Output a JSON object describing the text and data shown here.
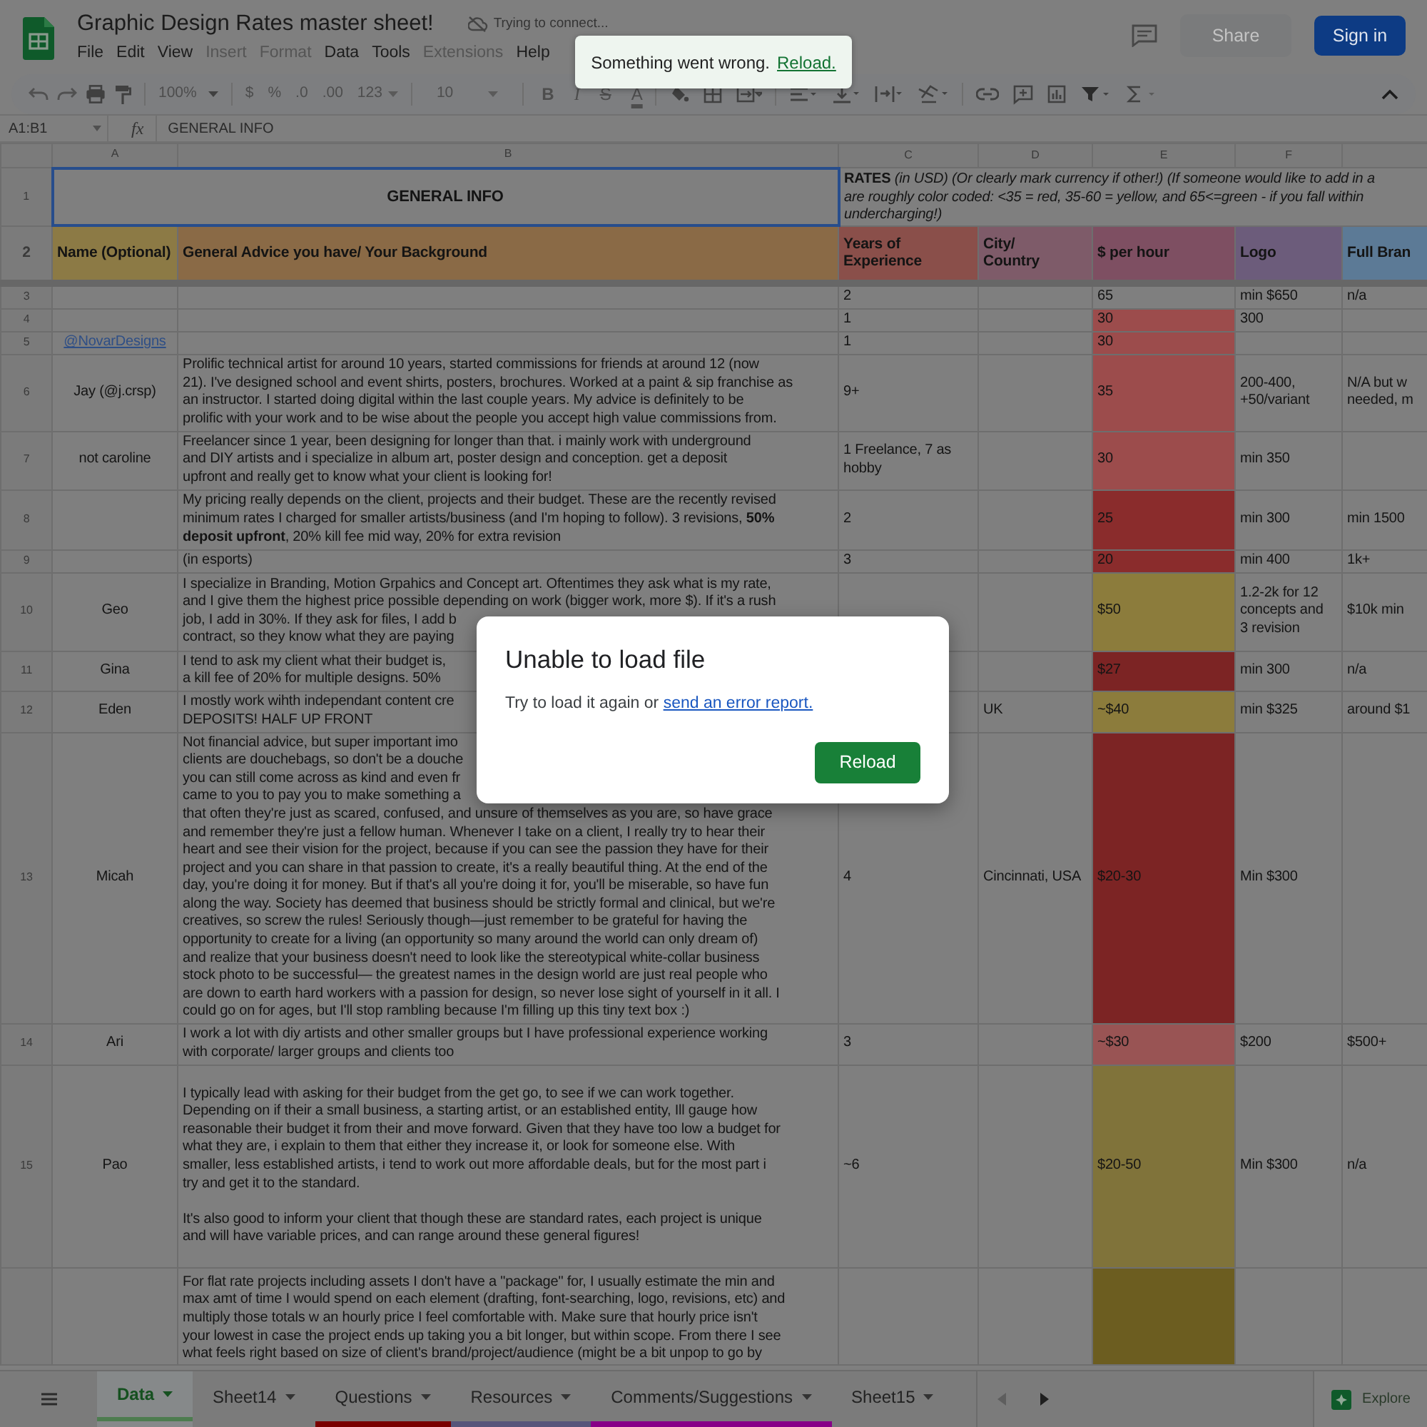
{
  "window": {
    "title": "Graphic Design Rates master sheet!",
    "connection_status": "Trying to connect..."
  },
  "menu": [
    {
      "label": "File",
      "disabled": false
    },
    {
      "label": "Edit",
      "disabled": false
    },
    {
      "label": "View",
      "disabled": false
    },
    {
      "label": "Insert",
      "disabled": true
    },
    {
      "label": "Format",
      "disabled": true
    },
    {
      "label": "Data",
      "disabled": false
    },
    {
      "label": "Tools",
      "disabled": false
    },
    {
      "label": "Extensions",
      "disabled": true
    },
    {
      "label": "Help",
      "disabled": false
    }
  ],
  "header_buttons": {
    "share": {
      "label": "Share",
      "disabled": true
    },
    "sign_in": "Sign in"
  },
  "toolbar": {
    "zoom": "100%",
    "currency": "$",
    "percent": "%",
    "decrease_decimals": ".0",
    "increase_decimals": ".00",
    "number_format": "123",
    "font_size": "10",
    "bold": "B",
    "italic": "I",
    "strikethrough": "S",
    "text_color": "A"
  },
  "formula_bar": {
    "name_box": "A1:B1",
    "fx": "fx",
    "value": "GENERAL INFO"
  },
  "sheet": {
    "columns": [
      "A",
      "B",
      "C",
      "D",
      "E",
      "F"
    ],
    "title_row": {
      "number": "1",
      "left": "GENERAL INFO",
      "right": [
        "**RATES** *(in USD) (Or clearly mark currency if other!) (If someone would like to add in a*",
        "*are roughly color coded: <35 = red, 35-60 = yellow, and 65<=green - if you fall within*",
        "*undercharging!)*"
      ]
    },
    "header_row": {
      "number": "2",
      "cells": [
        {
          "text": "Name (Optional)",
          "color": "#8c7a45"
        },
        {
          "text": "General Advice you have/ Your Background",
          "color": "#8a6a46"
        },
        {
          "text": "Years of\nExperience",
          "color": "#8a4f4a"
        },
        {
          "text": "City/\nCountry",
          "color": "#7e5b69"
        },
        {
          "text": "$ per hour",
          "color": "#7e4f62"
        },
        {
          "text": "Logo",
          "color": "#6c5c7b"
        },
        {
          "text": "Full Bran",
          "color": "#5c7a96"
        }
      ]
    },
    "rows": [
      {
        "number": "3",
        "a_link": false,
        "cells": {
          "c": "2",
          "e": "65",
          "f": "min $650",
          "g": "n/a"
        }
      },
      {
        "number": "4",
        "a_link": false,
        "color": "#9c4c4c",
        "cells": {
          "c": "1",
          "e": "30",
          "f": "300"
        }
      },
      {
        "number": "5",
        "a_link": true,
        "color": "#9c4c4c",
        "cells": {
          "a": "@NovarDesigns",
          "c": "1",
          "e": "30"
        }
      },
      {
        "number": "6",
        "a_link": false,
        "color": "#9c4c4c",
        "cells": {
          "a": "Jay (@j.crsp)",
          "b": "Prolific technical artist for around 10 years, started commissions for friends at around 12 (now\n21). I've designed school and event shirts, posters, brochures. Worked at a paint & sip franchise as\nan instructor. I started doing digital within the last couple years. My advice is definitely to be\nprolific with your work and to be wise about the people you accept high value commissions from.",
          "c": "9+",
          "e": "35",
          "f": "200-400,\n+50/variant",
          "g": "N/A but w\nneeded, m"
        }
      },
      {
        "number": "7",
        "a_link": false,
        "color": "#9c4c4c",
        "cells": {
          "a": "not caroline",
          "b": "Freelancer since 1 year, been designing for longer than that. i mainly work with underground\nand DIY artists and i specialize in album art, poster design and conception. get a deposit\nupfront and really get to know what your client is looking for!",
          "c": "1 Freelance, 7 as\nhobby",
          "e": "30",
          "f": "min 350"
        }
      },
      {
        "number": "8",
        "a_link": false,
        "color": "#8a2c2c",
        "cells": {
          "b": "My pricing really depends on the client, projects and their budget. These are the recently revised\nminimum rates I charged for smaller artists/business (and I'm hoping to follow). 3 revisions,  **50%**\n**deposit upfront**, 20% kill fee mid way, 20% for extra revision",
          "c": "2",
          "e": "25",
          "f": "min 300",
          "g": "min 1500"
        }
      },
      {
        "number": "9",
        "a_link": false,
        "color": "#8a2c2c",
        "cells": {
          "b": "(in esports)",
          "c": "3",
          "e": "20",
          "f": "min 400",
          "g": "1k+"
        }
      },
      {
        "number": "10",
        "a_link": false,
        "color": "#8c7c3c",
        "cells": {
          "a": "Geo",
          "b": [
            "I specialize in Branding, Motion Grpahics and Concept art. Oftentimes they ask what is my rate,",
            "and I give them the highest price possible depending on work (bigger work, more $). If it's a rush",
            "job, I add in 30%. If they ask for files, I add b",
            "contract, so they know what they are paying"
          ],
          "e": "$50",
          "f": "1.2-2k for 12\nconcepts and\n3 revision",
          "g": "$10k min"
        }
      },
      {
        "number": "11",
        "a_link": false,
        "color": "#7c2424",
        "cells": {
          "a": "Gina",
          "b": [
            "I tend to ask my client what their  budget is,",
            "a kill  fee of 20% for multiple designs.  50%"
          ],
          "e": "$27",
          "f": "min 300",
          "g": "n/a"
        }
      },
      {
        "number": "12",
        "a_link": false,
        "color": "#8c7c3c",
        "cells": {
          "a": "Eden",
          "b": [
            "I mostly work wihth independant content cre",
            "DEPOSITS! HALF UP FRONT"
          ],
          "d": "UK",
          "e": "~$40",
          "f": "min $325",
          "g": "around $1"
        }
      },
      {
        "number": "13",
        "a_link": false,
        "color": "#7c2424",
        "cells": {
          "a": "Micah",
          "b": [
            "Not financial advice, but super important imo",
            "clients are douchebags, so don't be a douche",
            "you can still come across as kind and even fr",
            "came to you to pay you to make something a",
            "that often they're just as scared, confused, and unsure of themselves as you are, so have grace",
            "and remember they're just a fellow human. Whenever I take on a client, I really try to hear their",
            "heart and see their vision for the project, because if you can see the passion they have for their",
            "project and you can share in that passion to create, it's a really beautiful thing. At the end of the",
            "day, you're doing it for money. But if that's all you're doing it for, you'll be miserable, so have fun",
            "along the way. Society has deemed that business should be strictly formal and clinical, but we're",
            "creatives, so screw the rules! Seriously though—just remember to be grateful for having the",
            "opportunity to create for a living (an opportunity so many around the world can only dream of)",
            "and realize that your business doesn't need to look like the stereotypical white-collar business",
            "stock photo to be successful— the greatest names in the design world are just real people who",
            "are down to earth hard workers with a passion for design, so never lose sight of yourself in it all. I",
            "could go on for ages, but I'll stop rambling because I'm filling up this tiny text box :)"
          ],
          "c": "4",
          "d": "Cincinnati, USA",
          "e": "$20-30",
          "f": "Min $300"
        }
      },
      {
        "number": "14",
        "a_link": false,
        "color": "#995454",
        "cells": {
          "a": "Ari",
          "b": "I work a lot with diy artists and other smaller groups but I have professional experience working\nwith corporate/ larger groups and clients too",
          "c": "3",
          "e": "~$30",
          "f": "$200",
          "g": "$500+"
        }
      },
      {
        "number": "15",
        "a_link": false,
        "color": "#80733a",
        "cells": {
          "a": "Pao",
          "b": "I typically lead with asking for their budget from the get go, to see if we can work together.\nDepending on if their a small business, a starting artist, or an established entity, Ill gauge how\nreasonable their budget it from their and move forward. Given that they have too low a budget for\nwhat they are, i explain to them that either they increase it, or look for someone else. With\nsmaller, less established artists, i tend to work out more affordable deals, but for the most part i\ntry and get it to the standard.\n\nIt's also good to inform your client that though these are standard rates, each project is unique\nand will have variable prices, and can range around these general figures!",
          "c": "~6",
          "e": "$20-50",
          "f": "Min $300",
          "g": "n/a"
        }
      },
      {
        "a_link": false,
        "color": "#6c5d20",
        "cells": {
          "b": "For flat rate projects including assets I don't have a \"package\" for, I usually estimate the min and\nmax amt of time I would spend on each element (drafting, font-searching, logo, revisions, etc) and\nmultiply those totals w an hourly price I feel comfortable with. Make sure that hourly price isn't\nyour lowest in case the project ends up taking you a bit longer, but within scope. From there I see\nwhat feels right based on size of client's brand/project/audience (might be a bit unpop to go by"
        }
      }
    ]
  },
  "sheet_tabs": [
    {
      "label": "Data",
      "selected": true
    },
    {
      "label": "Sheet14",
      "selected": false
    },
    {
      "label": "Questions",
      "selected": false,
      "color": "#7a0000"
    },
    {
      "label": "Resources",
      "selected": false,
      "color": "#57557a"
    },
    {
      "label": "Comments/Suggestions",
      "selected": false,
      "color": "#870087"
    },
    {
      "label": "Sheet15",
      "selected": false
    }
  ],
  "explore": "Explore",
  "toast": {
    "message": "Something went wrong.",
    "action": "Reload."
  },
  "dialog": {
    "title": "Unable to load file",
    "body": "Try to load it again or",
    "link": "send an error report.",
    "button": "Reload"
  }
}
